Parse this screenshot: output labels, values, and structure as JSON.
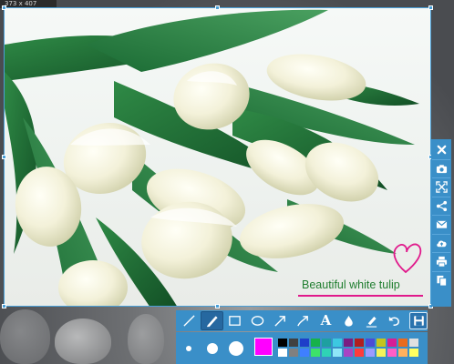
{
  "selection": {
    "size_readout": "373 x 407"
  },
  "capture": {
    "annotation_text": "Beautiful white tulip",
    "annotation_text_color": "#1e7d2e",
    "annotation_mark_color": "#e0198b"
  },
  "side_toolbar": {
    "buttons": [
      {
        "name": "close",
        "icon": "close-icon"
      },
      {
        "name": "camera",
        "icon": "camera-icon"
      },
      {
        "name": "fullscreen",
        "icon": "expand-icon"
      },
      {
        "name": "share",
        "icon": "share-icon"
      },
      {
        "name": "email",
        "icon": "mail-icon"
      },
      {
        "name": "upload",
        "icon": "cloud-upload-icon"
      },
      {
        "name": "print",
        "icon": "printer-icon"
      },
      {
        "name": "copy",
        "icon": "copy-icon"
      }
    ]
  },
  "edit_toolbar": {
    "tools": [
      {
        "name": "line",
        "icon": "line-icon",
        "active": false
      },
      {
        "name": "pen",
        "icon": "pen-icon",
        "active": true
      },
      {
        "name": "rectangle",
        "icon": "rectangle-icon",
        "active": false
      },
      {
        "name": "ellipse",
        "icon": "ellipse-icon",
        "active": false
      },
      {
        "name": "arrow",
        "icon": "arrow-icon",
        "active": false
      },
      {
        "name": "curved-arrow",
        "icon": "curved-arrow-icon",
        "active": false
      },
      {
        "name": "text",
        "icon": "text-icon",
        "active": false
      },
      {
        "name": "blur",
        "icon": "droplet-icon",
        "active": false
      },
      {
        "name": "highlighter",
        "icon": "marker-icon",
        "active": false
      },
      {
        "name": "undo",
        "icon": "undo-icon",
        "active": false
      },
      {
        "name": "save",
        "icon": "save-icon",
        "active": false
      }
    ],
    "text_tool_glyph": "A"
  },
  "options": {
    "brush_sizes": [
      "small",
      "medium",
      "large"
    ],
    "current_color": "#ff00ff",
    "palette": [
      "#000000",
      "#404040",
      "#1e3fc9",
      "#17b24a",
      "#1ea0a0",
      "#3cc8e0",
      "#7a1e82",
      "#b01e1e",
      "#4b4bd6",
      "#c4c41e",
      "#d61e96",
      "#e86b1e",
      "#e0e0e0",
      "#ffffff",
      "#808080",
      "#3f7fff",
      "#3de26a",
      "#2fd3b5",
      "#8fe7f7",
      "#a844c4",
      "#ff3b3b",
      "#9b9bff",
      "#f3f35a",
      "#ff5ec7",
      "#ffb15e",
      "#ffff60"
    ]
  }
}
